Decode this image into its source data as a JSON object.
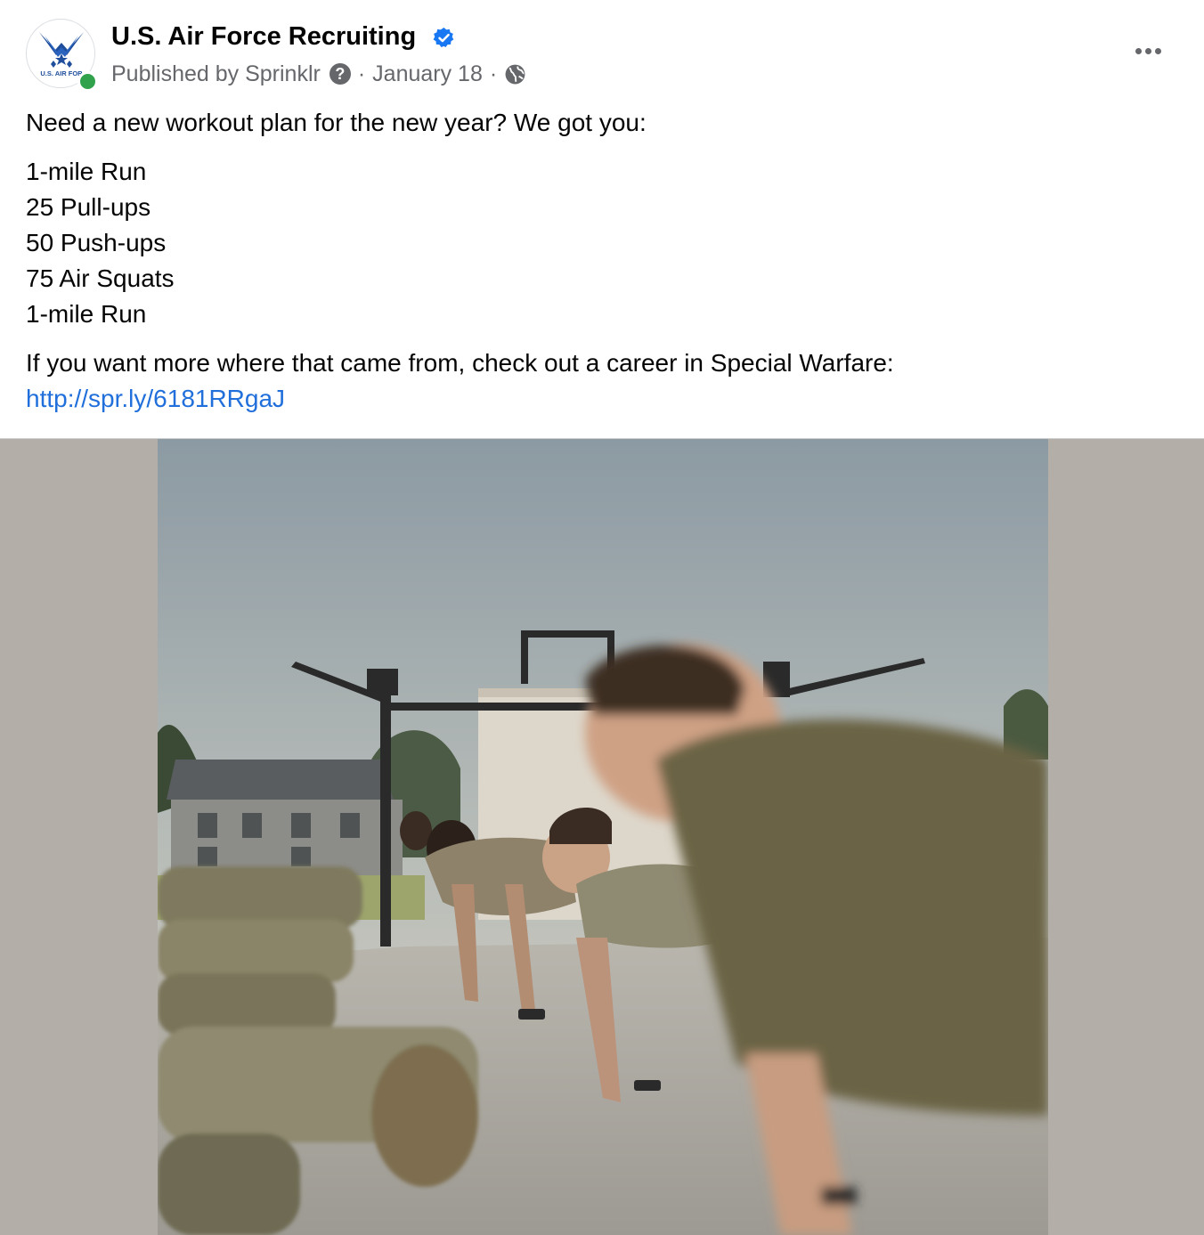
{
  "header": {
    "page_name": "U.S. Air Force Recruiting",
    "avatar_text": "U.S. AIR FOR",
    "published_by": "Published by Sprinklr",
    "help_glyph": "?",
    "date": "January 18",
    "separator": "·",
    "audience_icon": "globe-icon",
    "verified_icon": "verified-badge-icon",
    "more_icon": "more-options-icon"
  },
  "post": {
    "intro": "Need a new workout plan for the new year? We got you:",
    "workout": [
      "1-mile Run",
      "25 Pull-ups",
      "50 Push-ups",
      "75 Air Squats",
      "1-mile Run"
    ],
    "outro": "If you want more where that came from, check out a career in Special Warfare:",
    "link": "http://spr.ly/6181RRgaJ"
  },
  "colors": {
    "link": "#216fdb",
    "verified": "#1877f2",
    "online": "#31a24c",
    "secondary_text": "#65676b",
    "photo_letterbox": "#b3afa8"
  }
}
